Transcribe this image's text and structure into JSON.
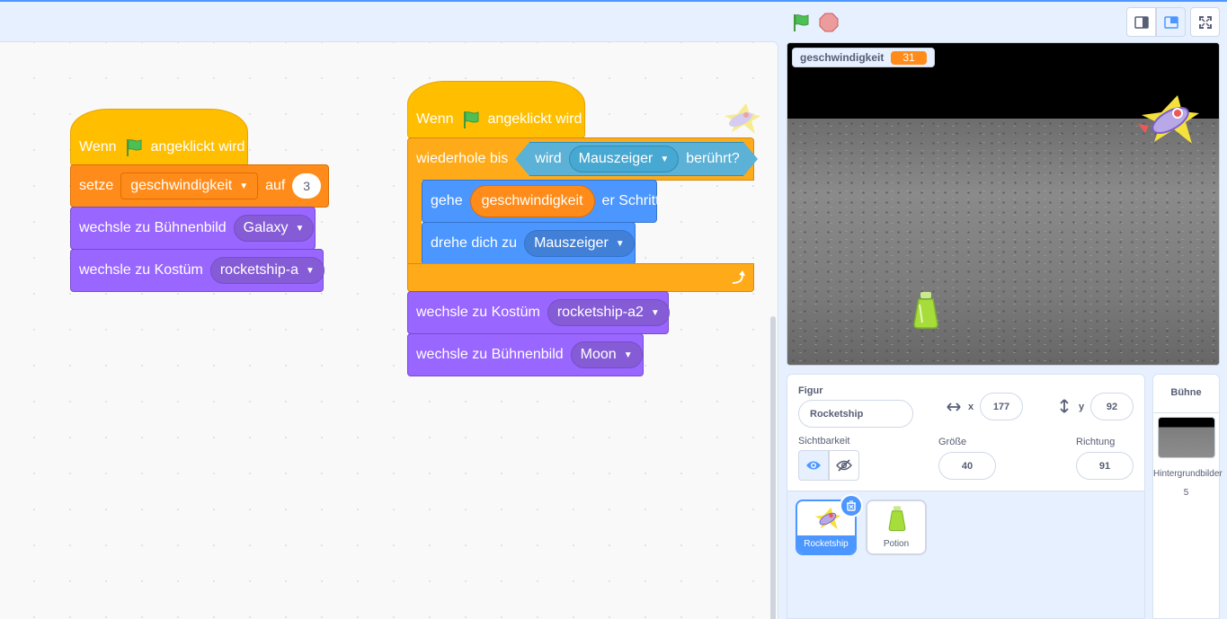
{
  "colors": {
    "accent": "#4c97ff",
    "events": "#ffbf00",
    "control": "#ffab19",
    "variables": "#ff8c1a",
    "looks": "#9966ff",
    "motion": "#4c97ff",
    "sensing": "#5cb1d6"
  },
  "script1": {
    "hat": {
      "before": "Wenn",
      "after": "angeklickt wird"
    },
    "set": {
      "label": "setze",
      "variable": "geschwindigkeit",
      "to": "auf",
      "value": "3"
    },
    "backdrop": {
      "label": "wechsle zu Bühnenbild",
      "value": "Galaxy"
    },
    "costume": {
      "label": "wechsle zu Kostüm",
      "value": "rocketship-a"
    }
  },
  "script2": {
    "hat": {
      "before": "Wenn",
      "after": "angeklickt wird"
    },
    "repeat": {
      "label": "wiederhole bis",
      "cond_pre": "wird",
      "cond_target": "Mauszeiger",
      "cond_post": "berührt?"
    },
    "move": {
      "pre": "gehe",
      "reporter": "geschwindigkeit",
      "post": "er Schritt"
    },
    "turn": {
      "label": "drehe dich zu",
      "value": "Mauszeiger"
    },
    "costume": {
      "label": "wechsle zu Kostüm",
      "value": "rocketship-a2"
    },
    "backdrop": {
      "label": "wechsle zu Bühnenbild",
      "value": "Moon"
    }
  },
  "stage": {
    "monitor": {
      "name": "geschwindigkeit",
      "value": "31"
    }
  },
  "sprite_info": {
    "figure_label": "Figur",
    "name": "Rocketship",
    "x_label": "x",
    "x": "177",
    "y_label": "y",
    "y": "92",
    "visibility_label": "Sichtbarkeit",
    "size_label": "Größe",
    "size": "40",
    "direction_label": "Richtung",
    "direction": "91"
  },
  "sprites": [
    {
      "name": "Rocketship",
      "icon": "rocketship-icon",
      "selected": true
    },
    {
      "name": "Potion",
      "icon": "potion-icon",
      "selected": false
    }
  ],
  "stage_selector": {
    "title": "Bühne",
    "backdrops_label": "Hintergrundbilder",
    "backdrops_count": "5"
  }
}
